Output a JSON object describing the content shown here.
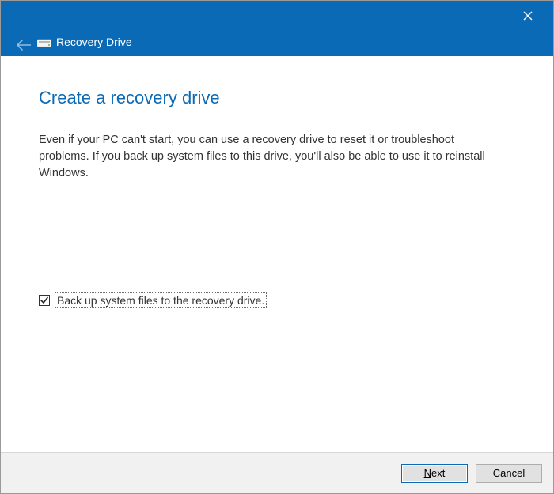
{
  "titlebar": {
    "title": "Recovery Drive"
  },
  "main": {
    "heading": "Create a recovery drive",
    "body": "Even if your PC can't start, you can use a recovery drive to reset it or troubleshoot problems. If you back up system files to this drive, you'll also be able to use it to reinstall Windows."
  },
  "checkbox": {
    "checked": true,
    "label": "Back up system files to the recovery drive."
  },
  "footer": {
    "next_prefix": "N",
    "next_rest": "ext",
    "cancel": "Cancel"
  }
}
